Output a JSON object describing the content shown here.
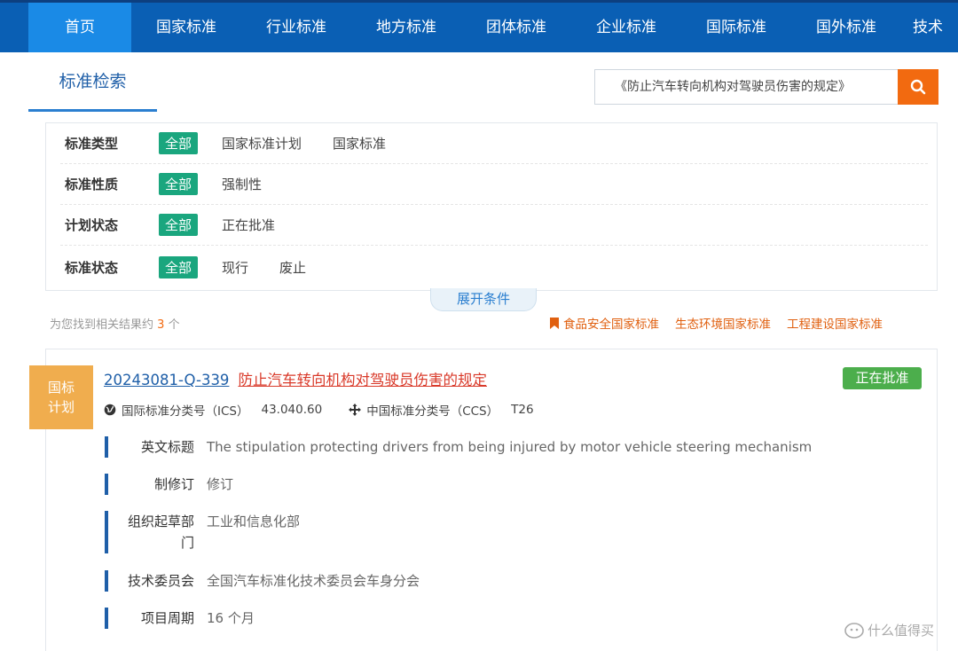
{
  "nav": {
    "items": [
      "首页",
      "国家标准",
      "行业标准",
      "地方标准",
      "团体标准",
      "企业标准",
      "国际标准",
      "国外标准",
      "技术"
    ]
  },
  "search": {
    "tab_label": "标准检索",
    "query": "《防止汽车转向机构对驾驶员伤害的规定》"
  },
  "filters": [
    {
      "label": "标准类型",
      "all": "全部",
      "options": [
        "国家标准计划",
        "国家标准"
      ]
    },
    {
      "label": "标准性质",
      "all": "全部",
      "options": [
        "强制性"
      ]
    },
    {
      "label": "计划状态",
      "all": "全部",
      "options": [
        "正在批准"
      ]
    },
    {
      "label": "标准状态",
      "all": "全部",
      "options": [
        "现行",
        "废止"
      ]
    }
  ],
  "expand_label": "展开条件",
  "results": {
    "prefix": "为您找到相关结果约",
    "count": "3",
    "suffix": "个"
  },
  "quick_links": [
    "食品安全国家标准",
    "生态环境国家标准",
    "工程建设国家标准"
  ],
  "item": {
    "badge_line1": "国标",
    "badge_line2": "计划",
    "code": "20243081-Q-339",
    "title": "防止汽车转向机构对驾驶员伤害的规定",
    "status": "正在批准",
    "ics_label": "国际标准分类号（ICS）",
    "ics_value": "43.040.60",
    "ccs_label": "中国标准分类号（CCS）",
    "ccs_value": "T26",
    "details": [
      {
        "label": "英文标题",
        "value": "The stipulation protecting drivers from being injured by motor vehicle steering mechanism"
      },
      {
        "label": "制修订",
        "value": "修订"
      },
      {
        "label": "组织起草部门",
        "value": "工业和信息化部"
      },
      {
        "label": "技术委员会",
        "value": "全国汽车标准化技术委员会车身分会"
      },
      {
        "label": "项目周期",
        "value": "16 个月"
      }
    ]
  },
  "watermark": "什么值得买",
  "colors": {
    "nav": "#0a5fb4",
    "accent": "#f26a10",
    "chip": "#1aa67e",
    "status": "#4cae4c",
    "badge": "#f0ad4e"
  }
}
